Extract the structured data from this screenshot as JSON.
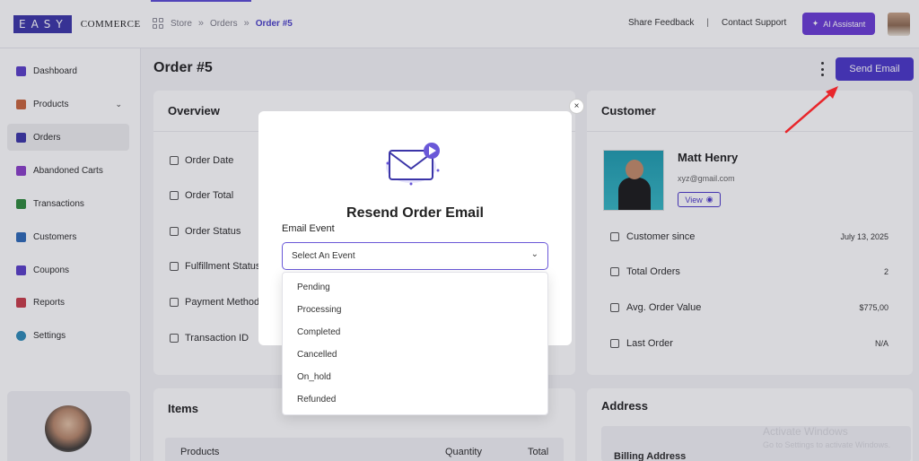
{
  "logo": {
    "brand_box": "EASY",
    "brand_text": "COMMERCE"
  },
  "breadcrumb": {
    "items": [
      "Store",
      "Orders"
    ],
    "current": "Order #5"
  },
  "header": {
    "share_feedback": "Share Feedback",
    "separator": "|",
    "contact_support": "Contact Support",
    "ai_assistant": "AI Assistant"
  },
  "sidebar": {
    "items": [
      {
        "label": "Dashboard",
        "icon": "dashboard-icon",
        "color": "#5a3fc8"
      },
      {
        "label": "Products",
        "icon": "products-icon",
        "color": "#c8643c"
      },
      {
        "label": "Orders",
        "icon": "orders-icon",
        "color": "#3b35a8"
      },
      {
        "label": "Abandoned Carts",
        "icon": "cart-icon",
        "color": "#8a3fc8"
      },
      {
        "label": "Transactions",
        "icon": "transactions-icon",
        "color": "#2e8a3c"
      },
      {
        "label": "Customers",
        "icon": "customers-icon",
        "color": "#2e6ab8"
      },
      {
        "label": "Coupons",
        "icon": "coupons-icon",
        "color": "#5a3fc8"
      },
      {
        "label": "Reports",
        "icon": "reports-icon",
        "color": "#c83c4a"
      },
      {
        "label": "Settings",
        "icon": "settings-icon",
        "color": "#2e8ab8"
      }
    ],
    "active_index": 2
  },
  "page": {
    "title": "Order #5",
    "send_email": "Send Email"
  },
  "overview": {
    "title": "Overview",
    "rows": [
      "Order Date",
      "Order Total",
      "Order Status",
      "Fulfillment Status",
      "Payment Method",
      "Transaction ID"
    ]
  },
  "customer": {
    "title": "Customer",
    "name": "Matt Henry",
    "email": "xyz@gmail.com",
    "view": "View",
    "rows": [
      {
        "label": "Customer since",
        "value": "July 13, 2025"
      },
      {
        "label": "Total Orders",
        "value": "2"
      },
      {
        "label": "Avg. Order Value",
        "value": "$775,00"
      },
      {
        "label": "Last Order",
        "value": "N/A"
      }
    ]
  },
  "items": {
    "title": "Items",
    "columns": [
      "Products",
      "Quantity",
      "Total"
    ]
  },
  "address": {
    "title": "Address",
    "billing": "Billing Address"
  },
  "modal": {
    "title": "Resend Order Email",
    "field_label": "Email Event",
    "select_placeholder": "Select An Event",
    "options": [
      "Pending",
      "Processing",
      "Completed",
      "Cancelled",
      "On_hold",
      "Refunded"
    ],
    "close": "×"
  },
  "watermark": {
    "line1": "Activate Windows",
    "line2": "Go to Settings to activate Windows."
  },
  "colors": {
    "accent": "#4a36c8",
    "ai_button": "#6a3bd6",
    "annotation_arrow": "#e8262b"
  }
}
